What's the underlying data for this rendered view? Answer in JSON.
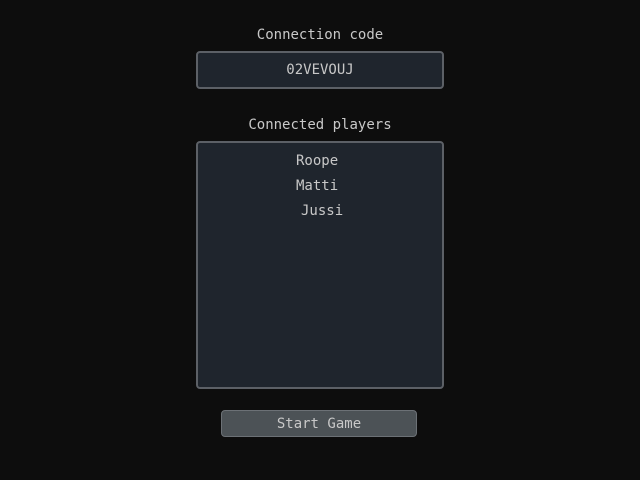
{
  "connection": {
    "label": "Connection code",
    "code": "02VEVOUJ"
  },
  "players": {
    "label": "Connected players",
    "list": [
      "Roope",
      "Matti",
      "Jussi"
    ]
  },
  "actions": {
    "start_label": "Start Game"
  },
  "colors": {
    "background": "#0d0d0d",
    "panel": "#1f252d",
    "panel_border": "#5c6066",
    "button": "#4c5256",
    "text": "#c8c8c8"
  }
}
